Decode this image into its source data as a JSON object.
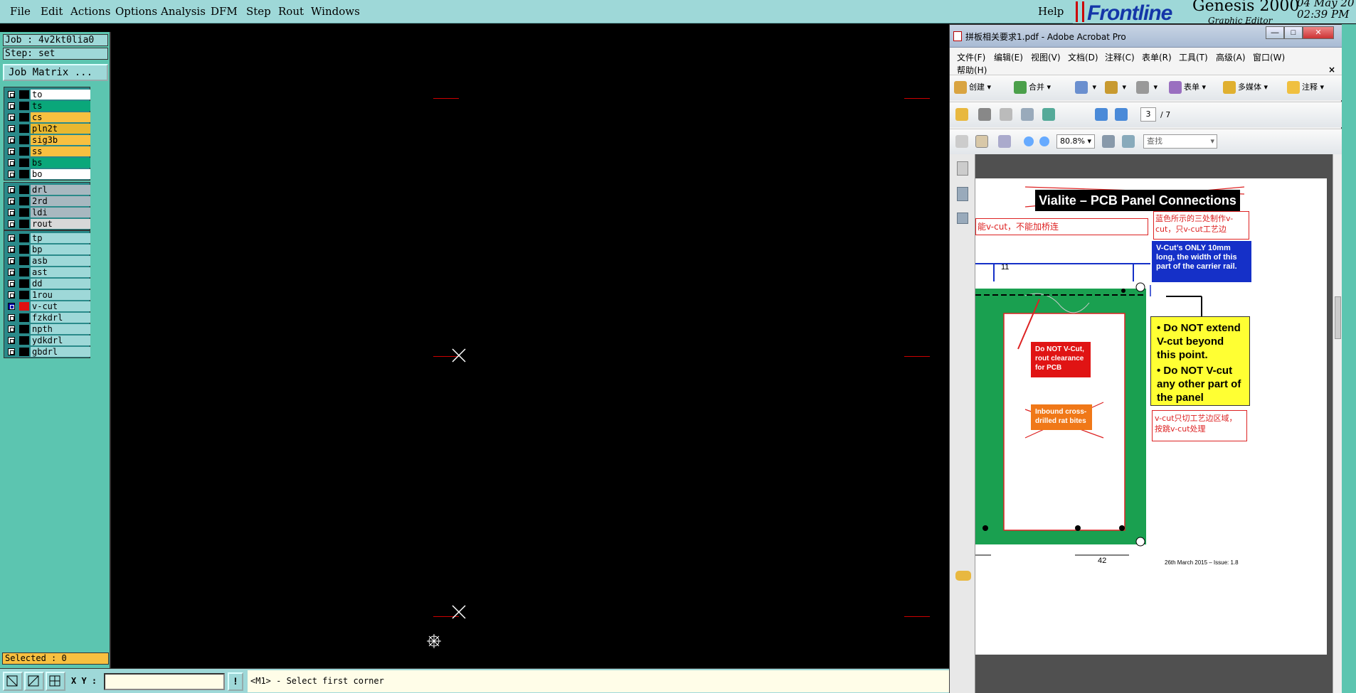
{
  "menu": [
    "File",
    "Edit",
    "Actions",
    "Options",
    "Analysis",
    "DFM",
    "Step",
    "Rout",
    "Windows"
  ],
  "help": "Help",
  "brand": {
    "logo": "Frontline",
    "product": "Genesis 2000",
    "subtitle": "Graphic Editor",
    "date": "04 May 20",
    "time": "02:39 PM"
  },
  "job": {
    "label": "Job : 4v2kt0lia0",
    "step": "Step: set",
    "matrix_button": "Job Matrix ..."
  },
  "layers": {
    "group1": [
      {
        "name": "to",
        "color": "#ffffff"
      },
      {
        "name": "ts",
        "color": "#0aa77a"
      },
      {
        "name": "cs",
        "color": "#f8c040"
      },
      {
        "name": "pln2t",
        "color": "#e8b830"
      },
      {
        "name": "sig3b",
        "color": "#f8c040"
      },
      {
        "name": "ss",
        "color": "#f8c040"
      },
      {
        "name": "bs",
        "color": "#0aa77a"
      },
      {
        "name": "bo",
        "color": "#ffffff"
      }
    ],
    "group2": [
      {
        "name": "drl",
        "color": "#a8b8c0"
      },
      {
        "name": "2rd",
        "color": "#a8b8c0"
      },
      {
        "name": "ldi",
        "color": "#a8b8c0"
      },
      {
        "name": "rout",
        "color": "#d8d8d8"
      }
    ],
    "group3": [
      {
        "name": "tp",
        "color": "#9ed8d8"
      },
      {
        "name": "bp",
        "color": "#9ed8d8"
      },
      {
        "name": "asb",
        "color": "#9ed8d8"
      },
      {
        "name": "ast",
        "color": "#9ed8d8"
      },
      {
        "name": "dd",
        "color": "#9ed8d8"
      },
      {
        "name": "1rou",
        "color": "#9ed8d8"
      },
      {
        "name": "v-cut",
        "color": "#9ed8d8",
        "active": true
      },
      {
        "name": "fzkdrl",
        "color": "#9ed8d8"
      },
      {
        "name": "npth",
        "color": "#9ed8d8"
      },
      {
        "name": "ydkdrl",
        "color": "#9ed8d8"
      },
      {
        "name": "gbdrl",
        "color": "#9ed8d8"
      }
    ]
  },
  "selected": "Selected : 0",
  "bottom": {
    "xy_label": "X Y :",
    "xy_value": "",
    "exclaim": "!",
    "status": "<M1> - Select first corner"
  },
  "acrobat": {
    "title": "拼板相关要求1.pdf - Adobe Acrobat Pro",
    "window_buttons": [
      "—",
      "□",
      "✕"
    ],
    "menu": [
      "文件(F)",
      "编辑(E)",
      "视图(V)",
      "文档(D)",
      "注释(C)",
      "表单(R)",
      "工具(T)",
      "高级(A)",
      "窗口(W)",
      "帮助(H)"
    ],
    "close_x": "×",
    "toolbar1": [
      "创建",
      "合并",
      "表单",
      "多媒体",
      "注释"
    ],
    "page": {
      "current": "3",
      "total": "/ 7"
    },
    "zoom": "80.8%",
    "find_placeholder": "查找"
  },
  "pdf": {
    "heading": "Vialite – PCB Panel Connections",
    "note_left": "能v-cut，不能加桥连",
    "note_right": "蓝色所示的三处制作v-cut，只v-cut工艺边",
    "blue_box": "V-Cut’s ONLY 10mm long, the width of this part of the carrier rail.",
    "dim_11": "11",
    "yellow_1": "Do NOT extend V-cut beyond this point.",
    "yellow_2": "Do NOT V-cut any other part of the panel",
    "red_box": "Do NOT V-Cut, rout clearance for PCB",
    "orange_box": "Inbound cross-drilled rat bites",
    "note_bottom": "v-cut只切工艺边区域，按跳v-cut处理",
    "dim_42": "42",
    "footer": "26th March 2015 – Issue: 1.8"
  },
  "colors": {
    "genesis_bg": "#9ed8d8",
    "panel": "#5cc5b0",
    "pcb_green": "#1aa050",
    "accent_red": "#cc0000"
  }
}
